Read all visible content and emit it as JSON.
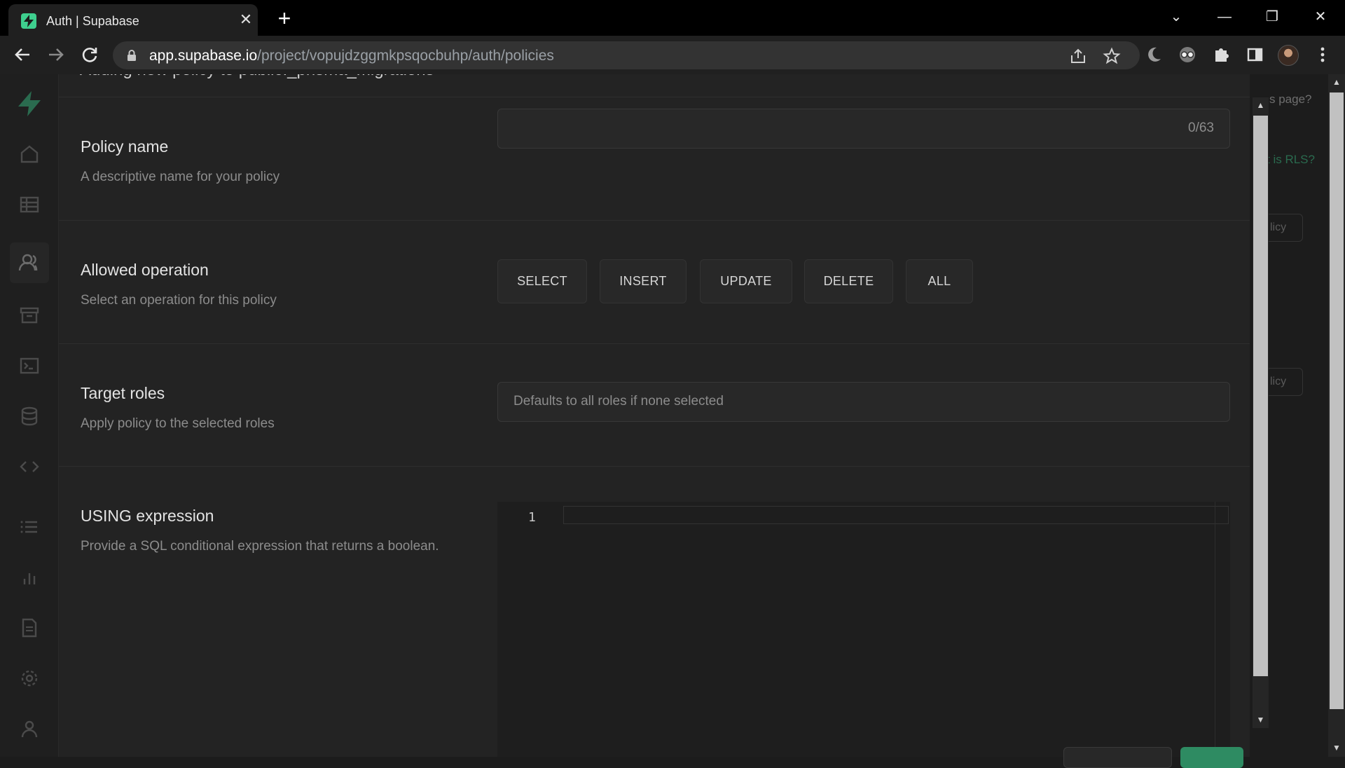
{
  "browser": {
    "tab_title": "Auth | Supabase",
    "tab_close": "✕",
    "new_tab": "+",
    "url_host": "app.supabase.io",
    "url_path": "/project/vopujdzggmkpsqocbuhp/auth/policies",
    "window_controls": [
      "⌄",
      "—",
      "❐",
      "✕"
    ]
  },
  "background_page": {
    "help_link_fragment": "s page?",
    "rls_link_fragment": "t is RLS?",
    "policy_btn_1": "licy",
    "policy_btn_2": "licy"
  },
  "panel": {
    "title": "Adding new policy to public._prisma_migrations",
    "policy_name": {
      "title": "Policy name",
      "description": "A descriptive name for your policy",
      "counter": "0/63"
    },
    "allowed_operation": {
      "title": "Allowed operation",
      "description": "Select an operation for this policy",
      "operations": [
        "SELECT",
        "INSERT",
        "UPDATE",
        "DELETE",
        "ALL"
      ]
    },
    "target_roles": {
      "title": "Target roles",
      "description": "Apply policy to the selected roles",
      "placeholder": "Defaults to all roles if none selected"
    },
    "using_expression": {
      "title": "USING expression",
      "description": "Provide a SQL conditional expression that returns a boolean.",
      "line_number": "1"
    }
  },
  "colors": {
    "accent": "#3ecf8e",
    "panel_bg": "#232323",
    "sidebar_bg": "#1f1f1f"
  }
}
